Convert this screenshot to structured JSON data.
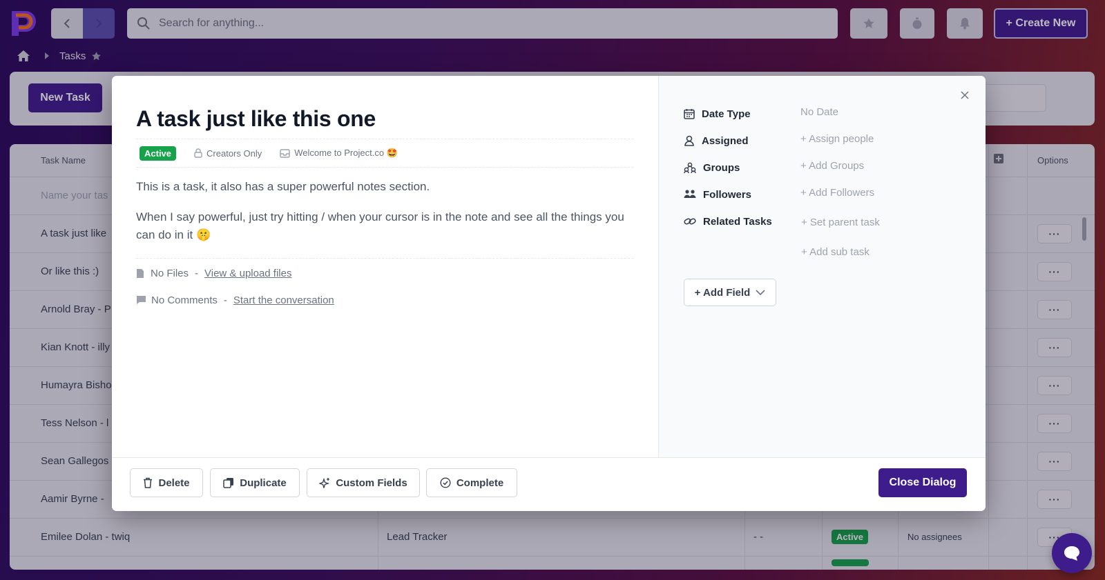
{
  "topbar": {
    "search_placeholder": "Search for anything...",
    "create_label": "+ Create New"
  },
  "breadcrumb": {
    "current": "Tasks"
  },
  "page": {
    "new_task_label": "New Task"
  },
  "table": {
    "headers": {
      "task_name": "Task Name",
      "options": "Options"
    },
    "new_row_placeholder": "Name your tas",
    "rows": [
      {
        "name": "A task just like"
      },
      {
        "name": "Or like this :)"
      },
      {
        "name": "Arnold Bray - P"
      },
      {
        "name": "Kian Knott - illy"
      },
      {
        "name": "Humayra Bisho"
      },
      {
        "name": "Tess Nelson - l"
      },
      {
        "name": "Sean Gallegos"
      },
      {
        "name": "Aamir Byrne -"
      },
      {
        "name": "Emilee Dolan - twiq",
        "project": "Lead Tracker",
        "date": "- -",
        "status": "Active",
        "assignees": "No assignees"
      }
    ],
    "options_glyph": "···"
  },
  "dialog": {
    "title": "A task just like this one",
    "status": "Active",
    "visibility": "Creators Only",
    "project": "Welcome to Project.co 🤩",
    "notes": [
      "This is a task, it also has a super powerful notes section.",
      "When I say powerful, just try hitting / when your cursor is in the note and see all the things you can do in it 🤫"
    ],
    "files_label": "No Files",
    "files_link": "View & upload files",
    "comments_label": "No Comments",
    "comments_link": "Start the conversation",
    "dash": "-",
    "fields": {
      "date_type": {
        "label": "Date Type",
        "value": "No Date"
      },
      "assigned": {
        "label": "Assigned",
        "value": "+ Assign people"
      },
      "groups": {
        "label": "Groups",
        "value": "+ Add Groups"
      },
      "followers": {
        "label": "Followers",
        "value": "+ Add Followers"
      },
      "related": {
        "label": "Related Tasks",
        "parent": "+ Set parent task",
        "sub": "+ Add sub task"
      }
    },
    "add_field_label": "+ Add Field",
    "footer": {
      "delete": "Delete",
      "duplicate": "Duplicate",
      "custom_fields": "Custom Fields",
      "complete": "Complete",
      "close": "Close Dialog"
    }
  },
  "colors": {
    "brand": "#3f1c8c",
    "active": "#16a34a"
  }
}
